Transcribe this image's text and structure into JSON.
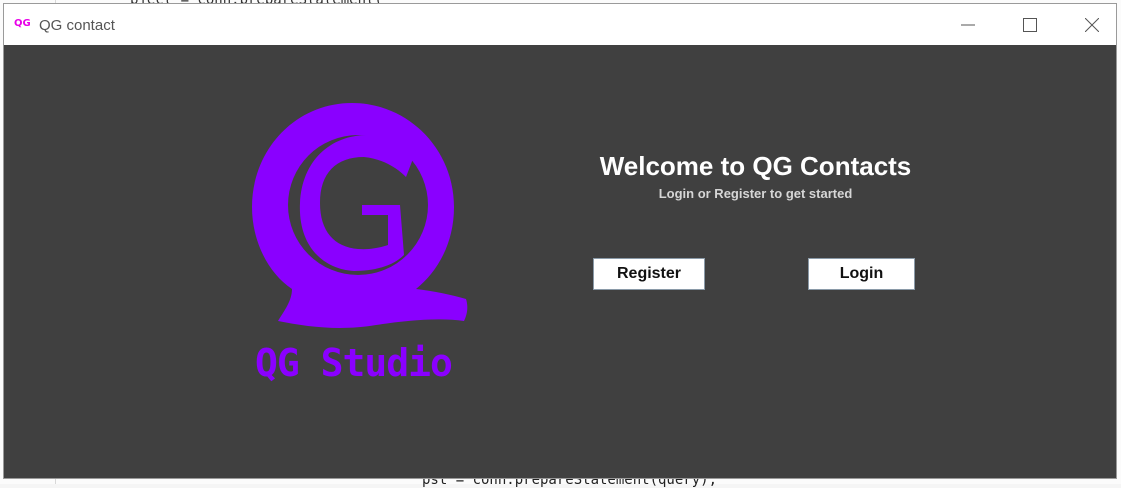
{
  "background_editor": {
    "top_code": "bject = conn.prepareStatement(",
    "bottom_code": "pst = conn.prepareStatement(query);"
  },
  "window": {
    "title": "QG contact",
    "icon": "qg-app-icon",
    "controls": {
      "minimize": "minimize-icon",
      "maximize": "maximize-icon",
      "close": "close-icon"
    }
  },
  "logo": {
    "letter": "G",
    "caption": "QG Studio",
    "color": "#8a00ff"
  },
  "welcome": {
    "title": "Welcome to QG Contacts",
    "subtitle": "Login or Register to get started"
  },
  "buttons": {
    "register": "Register",
    "login": "Login"
  },
  "colors": {
    "panel_background": "#404040",
    "brand": "#8a00ff",
    "title_icon": "#e800e8"
  }
}
